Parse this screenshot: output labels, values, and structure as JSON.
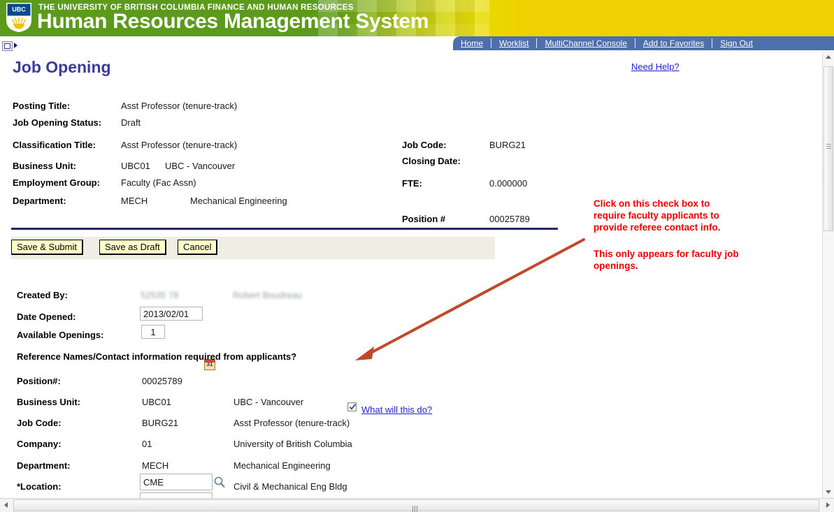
{
  "banner": {
    "org_line": "THE UNIVERSITY OF BRITISH COLUMBIA FINANCE AND HUMAN RESOURCES",
    "app_title": "Human Resources Management System",
    "logo_text": "UBC",
    "green": "#5c9a1b",
    "yellow": "#f0d000"
  },
  "nav": {
    "items": [
      {
        "label": "Home"
      },
      {
        "label": "Worklist"
      },
      {
        "label": "MultiChannel Console"
      },
      {
        "label": "Add to Favorites"
      },
      {
        "label": "Sign Out"
      }
    ],
    "bar_color": "#4d6fae"
  },
  "page": {
    "title": "Job Opening",
    "title_color": "#3b3b9e",
    "need_help": "Need Help?"
  },
  "summary": {
    "left": [
      {
        "label": "Posting Title:",
        "value": "Asst Professor (tenure-track)"
      },
      {
        "label": "Job Opening Status:",
        "value": "Draft"
      },
      {
        "label": "Classification Title:",
        "value": "Asst Professor (tenure-track)"
      },
      {
        "label": "Business Unit:",
        "code": "UBC01",
        "value": "UBC - Vancouver"
      },
      {
        "label": "Employment Group:",
        "value": "Faculty (Fac Assn)"
      },
      {
        "label": "Department:",
        "code": "MECH",
        "value": "Mechanical Engineering"
      }
    ],
    "right": [
      {
        "label": "Job Code:",
        "value": "BURG21"
      },
      {
        "label": "Closing Date:",
        "value": ""
      },
      {
        "label": "FTE:",
        "value": "0.000000"
      },
      {
        "label": "Position #",
        "value": "00025789"
      }
    ]
  },
  "buttons": {
    "save_submit": "Save & Submit",
    "save_draft": "Save as Draft",
    "cancel": "Cancel",
    "face_color": "#ffffcc",
    "band_color": "#eeeee4"
  },
  "form": {
    "created_by_label": "Created By:",
    "created_by_id": "52535 78",
    "created_by_name": "Robert Boudreau",
    "date_opened_label": "Date Opened:",
    "date_opened_value": "2013/02/01",
    "available_openings_label": "Available Openings:",
    "available_openings_value": "1",
    "reference_label": "Reference Names/Contact information required from applicants?",
    "reference_checked": true,
    "what_will_this_do": "What will this do?"
  },
  "position": {
    "rows": [
      {
        "label": "Position#:",
        "code": "00025789",
        "desc": ""
      },
      {
        "label": "Business Unit:",
        "code": "UBC01",
        "desc": "UBC - Vancouver"
      },
      {
        "label": "Job Code:",
        "code": "BURG21",
        "desc": "Asst Professor (tenure-track)"
      },
      {
        "label": "Company:",
        "code": "01",
        "desc": "University of British Columbia"
      },
      {
        "label": "Department:",
        "code": "MECH",
        "desc": "Mechanical Engineering"
      }
    ],
    "location_label": "*Location:",
    "location_value": "CME",
    "location_desc": "Civil & Mechanical Eng Bldg"
  },
  "annotation": {
    "color": "#ee0000",
    "arrow_color": "#c0492b",
    "para1_line1": "Click on this check box to",
    "para1_line2": "require faculty applicants to",
    "para1_line3": "provide referee contact info.",
    "para2_line1": "This only appears for faculty job",
    "para2_line2": "openings."
  }
}
